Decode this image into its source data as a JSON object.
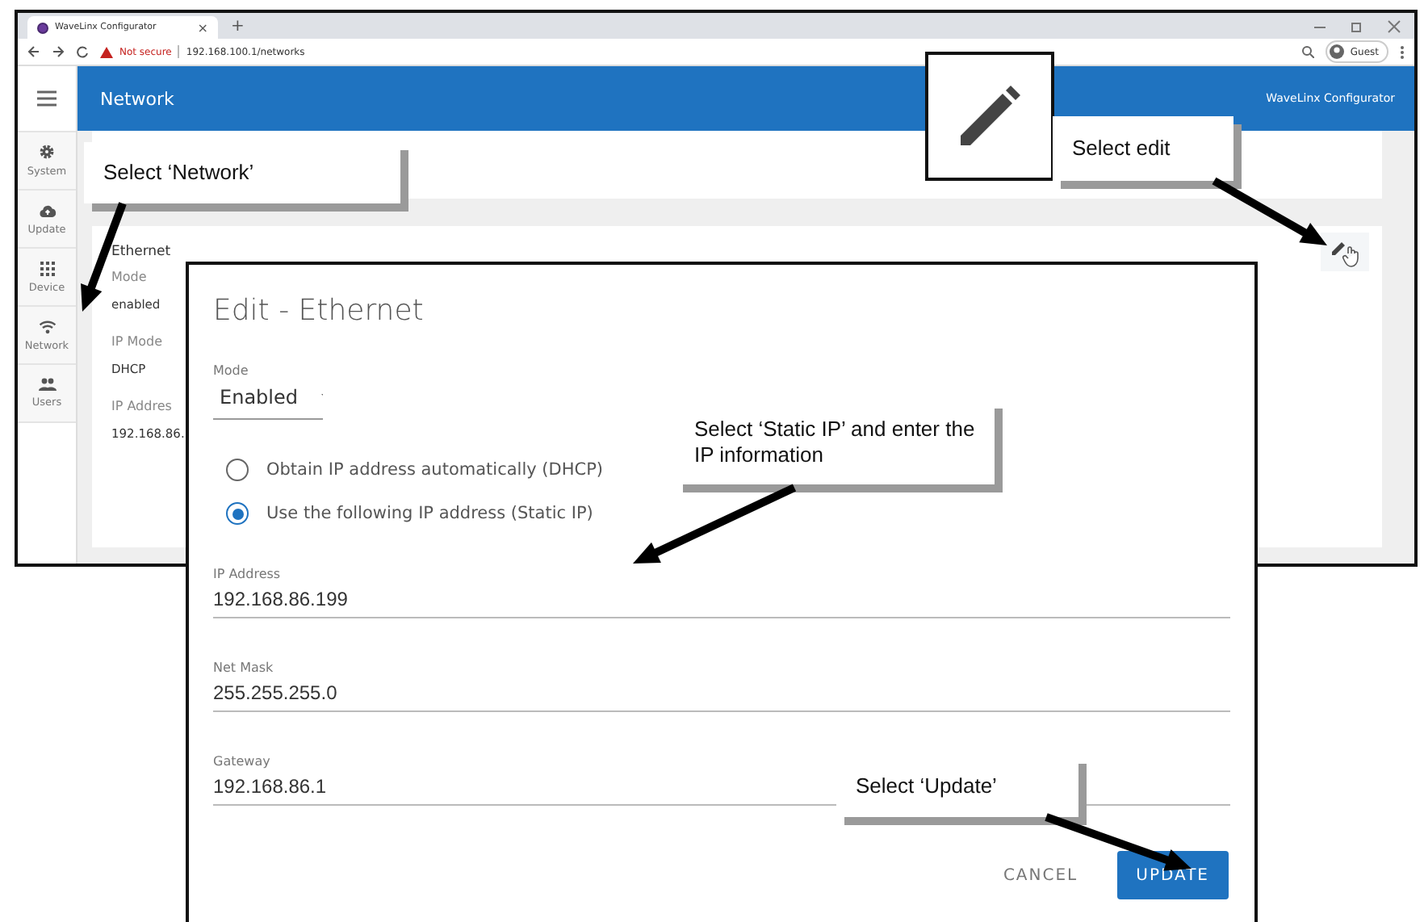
{
  "browser": {
    "tab_title": "WaveLinx Configurator",
    "tab_close": "×",
    "new_tab": "+",
    "url_warning": "Not secure",
    "url": "192.168.100.1/networks",
    "profile": "Guest"
  },
  "app": {
    "header_title": "Network",
    "app_name": "WaveLinx Configurator"
  },
  "sidebar": {
    "items": [
      {
        "label": "System"
      },
      {
        "label": "Update"
      },
      {
        "label": "Device"
      },
      {
        "label": "Network"
      },
      {
        "label": "Users"
      }
    ]
  },
  "ethernet_card": {
    "title": "Ethernet",
    "fields": [
      {
        "label": "Mode",
        "value": "enabled"
      },
      {
        "label": "IP Mode",
        "value": "DHCP"
      },
      {
        "label": "IP Addres",
        "value": "192.168.86."
      }
    ]
  },
  "dialog": {
    "title": "Edit - Ethernet",
    "mode": {
      "label": "Mode",
      "value": "Enabled"
    },
    "options": [
      {
        "label": "Obtain IP address automatically (DHCP)",
        "selected": false
      },
      {
        "label": "Use the following IP address (Static IP)",
        "selected": true
      }
    ],
    "fields": [
      {
        "label": "IP Address",
        "value": "192.168.86.199"
      },
      {
        "label": "Net Mask",
        "value": "255.255.255.0"
      },
      {
        "label": "Gateway",
        "value": "192.168.86.1"
      }
    ],
    "buttons": [
      {
        "label": "CANCEL",
        "kind": "text"
      },
      {
        "label": "UPDATE",
        "kind": "primary"
      }
    ]
  },
  "callouts": [
    {
      "text": "Select ‘Network’",
      "kind": "plain"
    },
    {
      "text": "Select edit",
      "kind": "with_icon"
    },
    {
      "text": "Select ‘Static IP’ and enter the IP information",
      "kind": "plain"
    },
    {
      "text": "Select ‘Update’",
      "kind": "plain"
    }
  ]
}
